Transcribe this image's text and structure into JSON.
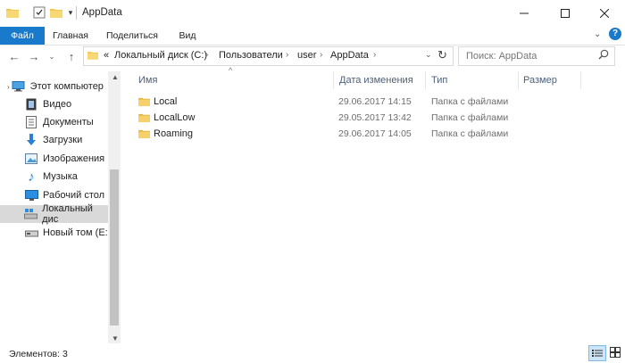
{
  "window": {
    "title": "AppData"
  },
  "ribbon": {
    "tabs": [
      "Файл",
      "Главная",
      "Поделиться",
      "Вид"
    ]
  },
  "address": {
    "overflow": "«",
    "crumbs": [
      "Локальный диск (C:)",
      "Пользователи",
      "user",
      "AppData"
    ]
  },
  "search": {
    "placeholder": "Поиск: AppData"
  },
  "nav": {
    "items": [
      {
        "label": "Этот компьютер",
        "icon": "computer-icon"
      },
      {
        "label": "Видео",
        "icon": "video-icon"
      },
      {
        "label": "Документы",
        "icon": "documents-icon"
      },
      {
        "label": "Загрузки",
        "icon": "download-icon"
      },
      {
        "label": "Изображения",
        "icon": "pictures-icon"
      },
      {
        "label": "Музыка",
        "icon": "music-icon"
      },
      {
        "label": "Рабочий стол",
        "icon": "desktop-icon"
      },
      {
        "label": "Локальный дис",
        "icon": "drive-icon",
        "selected": true
      },
      {
        "label": "Новый том (E:)",
        "icon": "drive-icon"
      }
    ]
  },
  "columns": {
    "name": "Имя",
    "date": "Дата изменения",
    "type": "Тип",
    "size": "Размер"
  },
  "files": [
    {
      "name": "Local",
      "date": "29.06.2017 14:15",
      "type": "Папка с файлами"
    },
    {
      "name": "LocalLow",
      "date": "29.05.2017 13:42",
      "type": "Папка с файлами"
    },
    {
      "name": "Roaming",
      "date": "29.06.2017 14:05",
      "type": "Папка с файлами"
    }
  ],
  "status": {
    "text": "Элементов: 3"
  },
  "colors": {
    "accent": "#1979ca",
    "folder": "#f3c54b"
  }
}
